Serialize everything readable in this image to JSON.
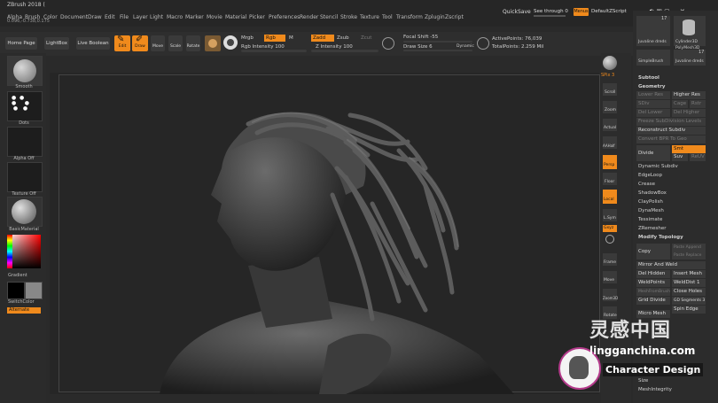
{
  "window": {
    "title": "ZBrush 2018 ("
  },
  "menu": {
    "items": [
      "Alpha",
      "Brush",
      "Color",
      "Document",
      "Draw",
      "Edit",
      "File",
      "Layer",
      "Light",
      "Macro",
      "Marker",
      "Movie",
      "Material",
      "Picker",
      "Preferences",
      "Render",
      "Stencil",
      "Stroke",
      "Texture",
      "Tool",
      "Transform",
      "Zplugin",
      "Zscript"
    ],
    "quicksave": "QuickSave",
    "see_through": "See through  0",
    "menus": "Menus",
    "default_zscript": "DefaultZScript",
    "coords": "0.096,-0.738,0.175"
  },
  "toolbar": {
    "home_page": "Home Page",
    "lightbox": "LightBox",
    "live_boolean": "Live Boolean",
    "edit": "Edit",
    "draw": "Draw",
    "move": "Move",
    "scale": "Scale",
    "rotate": "Rotate",
    "mrgb": "Mrgb",
    "rgb": "Rgb",
    "m": "M",
    "zadd": "Zadd",
    "zsub": "Zsub",
    "zcut": "Zcut",
    "rgb_intensity": "Rgb Intensity 100",
    "z_intensity": "Z Intensity 100",
    "focal_shift": "Focal Shift -55",
    "draw_size": "Draw Size 6",
    "dynamic": "Dynamic",
    "active_points": "ActivePoints: 76,039",
    "total_points": "TotalPoints: 2.259 Mil"
  },
  "left_tray": {
    "smooth": "Smooth",
    "dots": "Dots",
    "alpha_off": "Alpha Off",
    "texture_off": "Texture Off",
    "basic_material": "BasicMaterial",
    "gradient": "Gradient",
    "switch_color": "SwitchColor",
    "alternate": "Alternate"
  },
  "right_tools": [
    "SPix 3",
    "Scroll",
    "Zoom",
    "Actual",
    "AAHalf",
    "Persp",
    "Floor",
    "Local",
    "L.Sym",
    "Gxyz",
    "",
    "Frame",
    "Move",
    "Zoom3D",
    "Rotate",
    "",
    "Transp",
    "",
    ""
  ],
  "tool_palette": {
    "thumb1": "Juvaline dreds",
    "count1": "17",
    "thumb2": "Cylinder3D",
    "thumb3": "PolyMesh3D",
    "thumb4": "SimpleBrush",
    "thumb5": "Juvaline dreds",
    "count5": "17"
  },
  "subtool_panel": {
    "subtool": "Subtool",
    "geometry": "Geometry",
    "lower_res": "Lower Res",
    "higher_res": "Higher Res",
    "sdiv": "SDiv",
    "cage": "Cage",
    "rstr": "Rstr",
    "del_lower": "Del Lower",
    "del_higher": "Del Higher",
    "freeze_subdiv": "Freeze SubDivision Levels",
    "reconstruct_subdiv": "Reconstruct Subdiv",
    "convert_bpr": "Convert BPR To Geo",
    "divide": "Divide",
    "smt": "Smt",
    "suv": "Suv",
    "relax": "ReUV",
    "dynamic_subdiv": "Dynamic Subdiv",
    "edgeloop": "EdgeLoop",
    "crease": "Crease",
    "shadowbox": "ShadowBox",
    "claypolish": "ClayPolish",
    "dynamesh": "DynaMesh",
    "tessimate": "Tessimate",
    "zremesher": "ZRemesher",
    "modify_topology": "Modify Topology",
    "copy": "Copy",
    "paste_append": "Paste Append",
    "paste_replace": "Paste Replace",
    "mirror_and_weld": "Mirror And Weld",
    "del_hidden": "Del Hidden",
    "insert_mesh": "Insert Mesh",
    "weldpoints": "WeldPoints",
    "welddist": "WeldDist 1",
    "meshfrombrush": "MeshFromBrush",
    "close_holes": "Close Holes",
    "grid_divide": "Grid Divide",
    "gd_segments": "GD Segments 3",
    "spin_edge": "Spin Edge",
    "micro_mesh": "Micro Mesh",
    "size": "Size",
    "mesh_integrity": "MeshIntegrity"
  },
  "watermark": {
    "brand": "灵感中国",
    "url": "lingganchina.com",
    "caption": "Character Design"
  },
  "colors": {
    "accent": "#f08a1c",
    "panel": "#2c2c2c",
    "canvas": "#262626"
  }
}
